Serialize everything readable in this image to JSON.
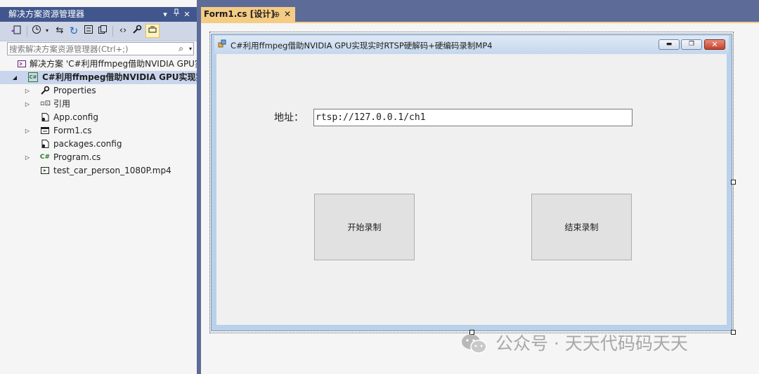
{
  "solution_explorer": {
    "title": "解决方案资源管理器",
    "controls": {
      "dropdown": "▾",
      "pin": "🖈",
      "close": "✕"
    },
    "search_placeholder": "搜索解决方案资源管理器(Ctrl+;)",
    "tree": [
      {
        "label": "解决方案 'C#利用ffmpeg借助NVIDIA GPU实现",
        "icon": "solution-icon",
        "arrow": ""
      },
      {
        "label": "C#利用ffmpeg借助NVIDIA GPU实现实时",
        "icon": "csharp-project-icon",
        "arrow": "◢"
      },
      {
        "label": "Properties",
        "icon": "wrench-icon",
        "arrow": "▷"
      },
      {
        "label": "引用",
        "icon": "references-icon",
        "arrow": "▷"
      },
      {
        "label": "App.config",
        "icon": "config-file-icon",
        "arrow": ""
      },
      {
        "label": "Form1.cs",
        "icon": "form-icon",
        "arrow": "▷"
      },
      {
        "label": "packages.config",
        "icon": "config-file-icon",
        "arrow": ""
      },
      {
        "label": "Program.cs",
        "icon": "csharp-file-icon",
        "arrow": "▷"
      },
      {
        "label": "test_car_person_1080P.mp4",
        "icon": "video-file-icon",
        "arrow": ""
      }
    ]
  },
  "document_tab": {
    "label": "Form1.cs [设计]",
    "pin": "⊕",
    "close": "✕"
  },
  "form": {
    "title": "C#利用ffmpeg借助NVIDIA GPU实现实时RTSP硬解码+硬编码录制MP4",
    "address_label": "地址：",
    "address_value": "rtsp://127.0.0.1/ch1",
    "start_button": "开始录制",
    "stop_button": "结束录制"
  },
  "watermark": "公众号 · 天天代码码天天",
  "colors": {
    "vs_frame": "#5d6b99",
    "tool_title": "#40568d",
    "tab_active": "#f5cc84",
    "form_border": "#b9d1ea"
  }
}
